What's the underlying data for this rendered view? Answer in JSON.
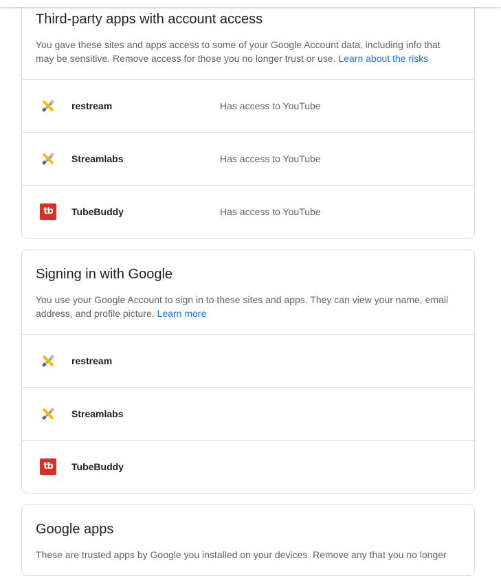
{
  "third_party": {
    "title": "Third-party apps with account access",
    "desc": "You gave these sites and apps access to some of your Google Account data, including info that may be sensitive. Remove access for those you no longer trust or use.",
    "link": "Learn about the risks",
    "apps": [
      {
        "name": "restream",
        "access": "Has access to YouTube",
        "icon": "default-app-icon"
      },
      {
        "name": "Streamlabs",
        "access": "Has access to YouTube",
        "icon": "default-app-icon"
      },
      {
        "name": "TubeBuddy",
        "access": "Has access to YouTube",
        "icon": "tubebuddy-logo-icon"
      }
    ]
  },
  "signin": {
    "title": "Signing in with Google",
    "desc": "You use your Google Account to sign in to these sites and apps. They can view your name, email address, and profile picture.",
    "link": "Learn more",
    "apps": [
      {
        "name": "restream",
        "icon": "default-app-icon"
      },
      {
        "name": "Streamlabs",
        "icon": "default-app-icon"
      },
      {
        "name": "TubeBuddy",
        "icon": "tubebuddy-logo-icon"
      }
    ]
  },
  "google_apps": {
    "title": "Google apps",
    "desc": "These are trusted apps by Google you installed on your devices. Remove any that you no longer"
  },
  "icons": {
    "tubebuddy_glyph": "tb"
  },
  "colors": {
    "link": "#1a73e8",
    "tubebuddy_red": "#d93025",
    "border": "#dadce0"
  }
}
